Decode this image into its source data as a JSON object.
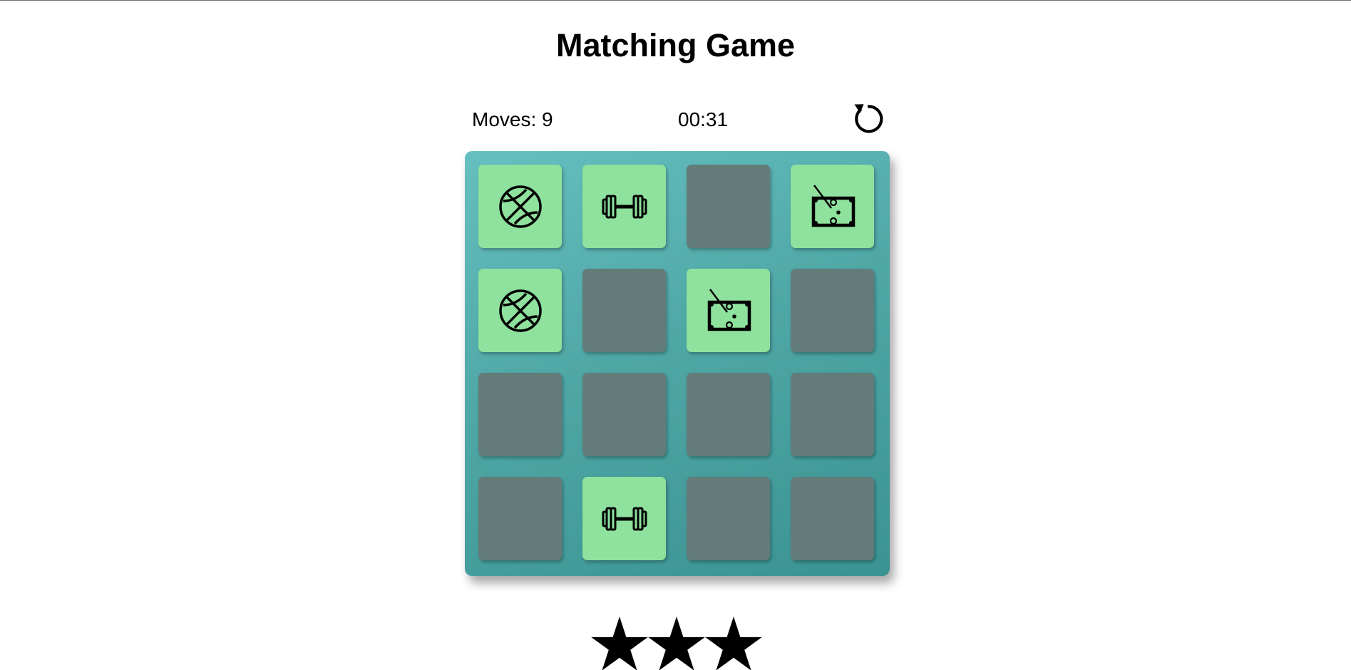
{
  "header": {
    "title": "Matching Game"
  },
  "score_panel": {
    "moves_label": "Moves: 9",
    "moves_count": 9,
    "timer": "00:31",
    "restart_icon": "restart-icon"
  },
  "deck": {
    "rows": 4,
    "columns": 4,
    "cards": [
      {
        "state": "open",
        "icon": "basketball-icon"
      },
      {
        "state": "open",
        "icon": "dumbbell-icon"
      },
      {
        "state": "closed",
        "icon": ""
      },
      {
        "state": "open",
        "icon": "billiards-table-icon"
      },
      {
        "state": "open",
        "icon": "basketball-icon"
      },
      {
        "state": "closed",
        "icon": ""
      },
      {
        "state": "open",
        "icon": "billiards-table-icon"
      },
      {
        "state": "closed",
        "icon": ""
      },
      {
        "state": "closed",
        "icon": ""
      },
      {
        "state": "closed",
        "icon": ""
      },
      {
        "state": "closed",
        "icon": ""
      },
      {
        "state": "closed",
        "icon": ""
      },
      {
        "state": "closed",
        "icon": ""
      },
      {
        "state": "open",
        "icon": "dumbbell-icon"
      },
      {
        "state": "closed",
        "icon": ""
      },
      {
        "state": "closed",
        "icon": ""
      }
    ]
  },
  "rating": {
    "stars": 3,
    "star_icon": "star-icon"
  },
  "colors": {
    "card_open": "#8fe19e",
    "card_closed": "#637c7a",
    "deck_gradient_start": "#66bfc0",
    "deck_gradient_end": "#3a9392"
  }
}
